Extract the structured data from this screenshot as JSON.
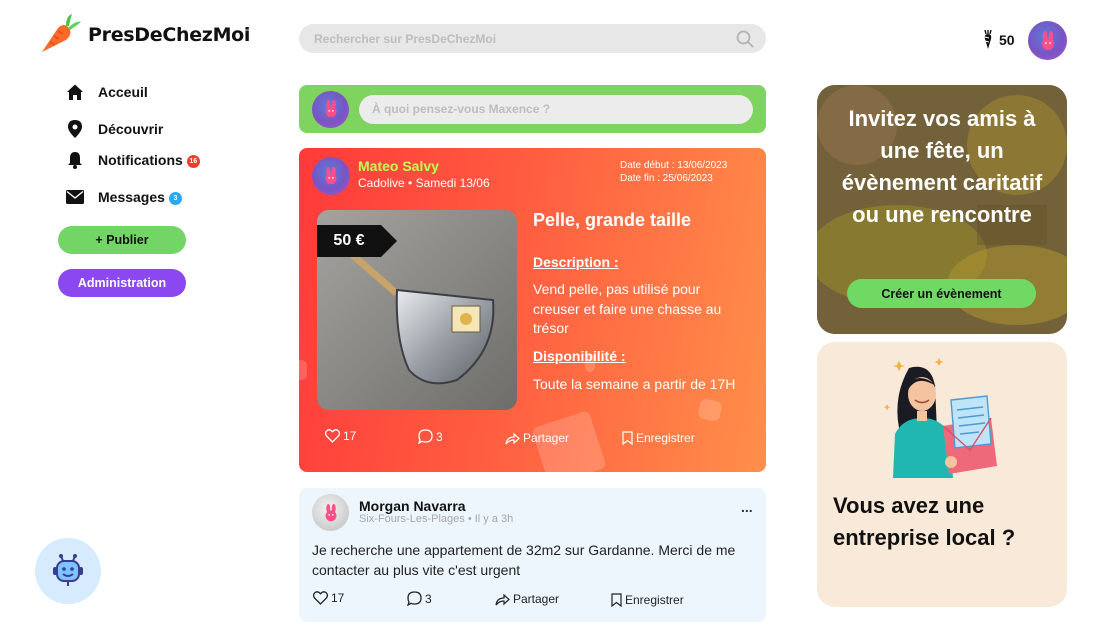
{
  "header": {
    "brand": "PresDeChezMoi",
    "search_placeholder": "Rechercher sur PresDeChezMoi",
    "coins": "50"
  },
  "sidebar": {
    "items": [
      {
        "label": "Acceuil",
        "icon": "home-icon"
      },
      {
        "label": "Découvrir",
        "icon": "location-pin-icon"
      },
      {
        "label": "Notifications",
        "icon": "bell-icon",
        "badge": "16",
        "badge_color": "#f23b2f"
      },
      {
        "label": "Messages",
        "icon": "envelope-icon",
        "badge": "3",
        "badge_color": "#2ea7f2"
      }
    ],
    "publish_label": "+ Publier",
    "admin_label": "Administration"
  },
  "composer": {
    "placeholder": "À quoi pensez-vous Maxence ?"
  },
  "featured_post": {
    "author": "Mateo Salvy",
    "meta": "Cadolive • Samedi 13/06",
    "date_start": "Date début : 13/06/2023",
    "date_end": "Date fin : 25/06/2023",
    "price": "50 €",
    "title": "Pelle, grande taille",
    "description_label": "Description :",
    "description": "Vend pelle, pas utilisé pour creuser et faire une chasse au trésor",
    "availability_label": "Disponibilité :",
    "availability": "Toute la semaine a partir de 17H",
    "likes": "17",
    "comments": "3",
    "share_label": "Partager",
    "save_label": "Enregistrer"
  },
  "post": {
    "author": "Morgan Navarra",
    "meta": "Six-Fours-Les-Plages • Il y a 3h",
    "more": "...",
    "text": "Je recherche une appartement de 32m2 sur Gardanne. Merci de me contacter au plus vite c'est urgent",
    "likes": "17",
    "comments": "3",
    "share_label": "Partager",
    "save_label": "Enregistrer"
  },
  "event_card": {
    "title": "Invitez vos amis à une fête, un évènement caritatif ou une rencontre",
    "button_label": "Créer un évènement"
  },
  "business_card": {
    "title": "Vous avez une entreprise local ?"
  },
  "colors": {
    "accent_green": "#72d566",
    "admin_purple": "#8b47f0",
    "featured_gradient_start": "#ff3a3a",
    "featured_gradient_end": "#ff8f4a",
    "author_highlight": "#b9ff4e",
    "post_background": "#eef6fd"
  }
}
